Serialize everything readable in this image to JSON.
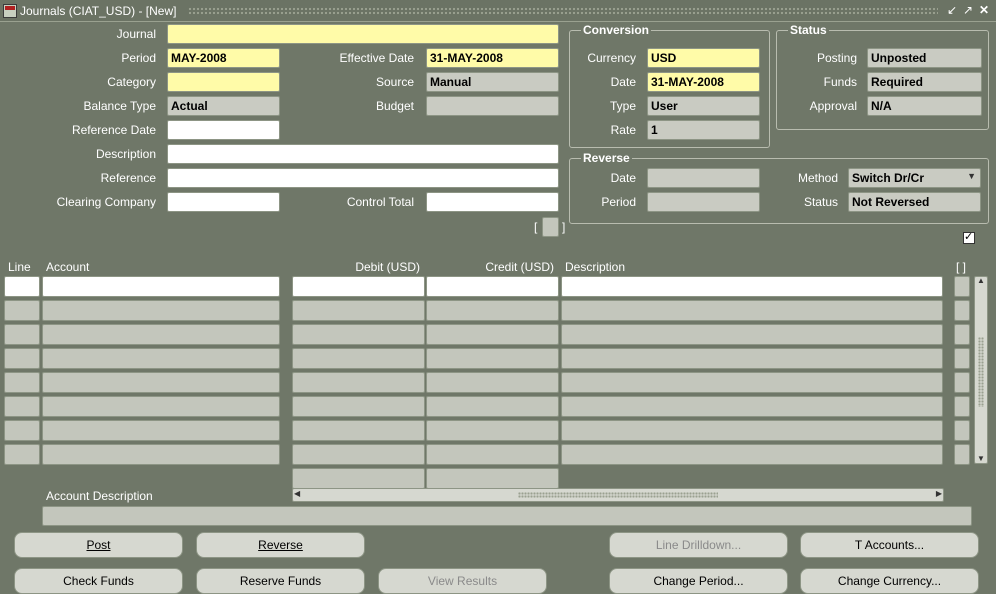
{
  "window": {
    "title": "Journals (CIAT_USD) - [New]"
  },
  "header": {
    "journal_label": "Journal",
    "journal_value": "",
    "period_label": "Period",
    "period_value": "MAY-2008",
    "effective_date_label": "Effective Date",
    "effective_date_value": "31-MAY-2008",
    "category_label": "Category",
    "category_value": "",
    "source_label": "Source",
    "source_value": "Manual",
    "balance_type_label": "Balance Type",
    "balance_type_value": "Actual",
    "budget_label": "Budget",
    "budget_value": "",
    "reference_date_label": "Reference Date",
    "reference_date_value": "",
    "description_label": "Description",
    "description_value": "",
    "reference_label": "Reference",
    "reference_value": "",
    "clearing_company_label": "Clearing Company",
    "clearing_company_value": "",
    "control_total_label": "Control Total",
    "control_total_value": ""
  },
  "conversion": {
    "title": "Conversion",
    "currency_label": "Currency",
    "currency_value": "USD",
    "date_label": "Date",
    "date_value": "31-MAY-2008",
    "type_label": "Type",
    "type_value": "User",
    "rate_label": "Rate",
    "rate_value": "1"
  },
  "status": {
    "title": "Status",
    "posting_label": "Posting",
    "posting_value": "Unposted",
    "funds_label": "Funds",
    "funds_value": "Required",
    "approval_label": "Approval",
    "approval_value": "N/A"
  },
  "reverse": {
    "title": "Reverse",
    "date_label": "Date",
    "date_value": "",
    "period_label": "Period",
    "period_value": "",
    "method_label": "Method",
    "method_value": "Switch Dr/Cr",
    "status_label": "Status",
    "status_value": "Not Reversed"
  },
  "lines": {
    "columns": [
      "Line",
      "Account",
      "Debit (USD)",
      "Credit (USD)",
      "Description",
      "[ ]"
    ],
    "row_count": 8,
    "account_description_label": "Account Description"
  },
  "buttons": {
    "post": "Post",
    "reverse": "Reverse",
    "line_drilldown": "Line Drilldown...",
    "t_accounts": "T Accounts...",
    "check_funds": "Check Funds",
    "reserve_funds": "Reserve Funds",
    "view_results": "View Results",
    "change_period": "Change Period...",
    "change_currency": "Change Currency..."
  },
  "colors": {
    "background": "#6f7768",
    "required_field": "#fffba8",
    "readonly_field": "#c9cbc2"
  }
}
